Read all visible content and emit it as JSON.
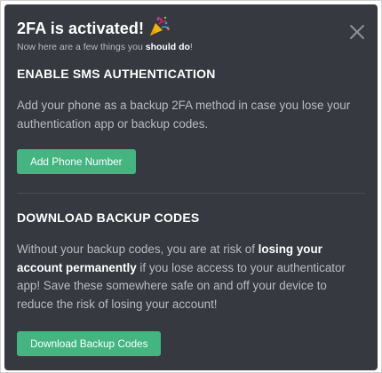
{
  "header": {
    "title": "2FA is activated!",
    "subtitle_prefix": "Now here are a few things you ",
    "subtitle_bold": "should do",
    "subtitle_suffix": "!",
    "party_icon": "party-popper-icon",
    "close_icon": "close-icon"
  },
  "sms_section": {
    "title": "ENABLE SMS AUTHENTICATION",
    "body": "Add your phone as a backup 2FA method in case you lose your authentication app or backup codes.",
    "button_label": "Add Phone Number"
  },
  "backup_section": {
    "title": "DOWNLOAD BACKUP CODES",
    "body_prefix": "Without your backup codes, you are at risk of ",
    "body_bold": "losing your account permanently",
    "body_suffix": " if you lose access to your authenticator app! Save these somewhere safe on and off your device to reduce the risk of losing your account!",
    "button_label": "Download Backup Codes"
  },
  "colors": {
    "modal_bg": "#36393f",
    "button_green": "#43b581",
    "text_white": "#ffffff",
    "text_muted": "#b9bbbe"
  }
}
